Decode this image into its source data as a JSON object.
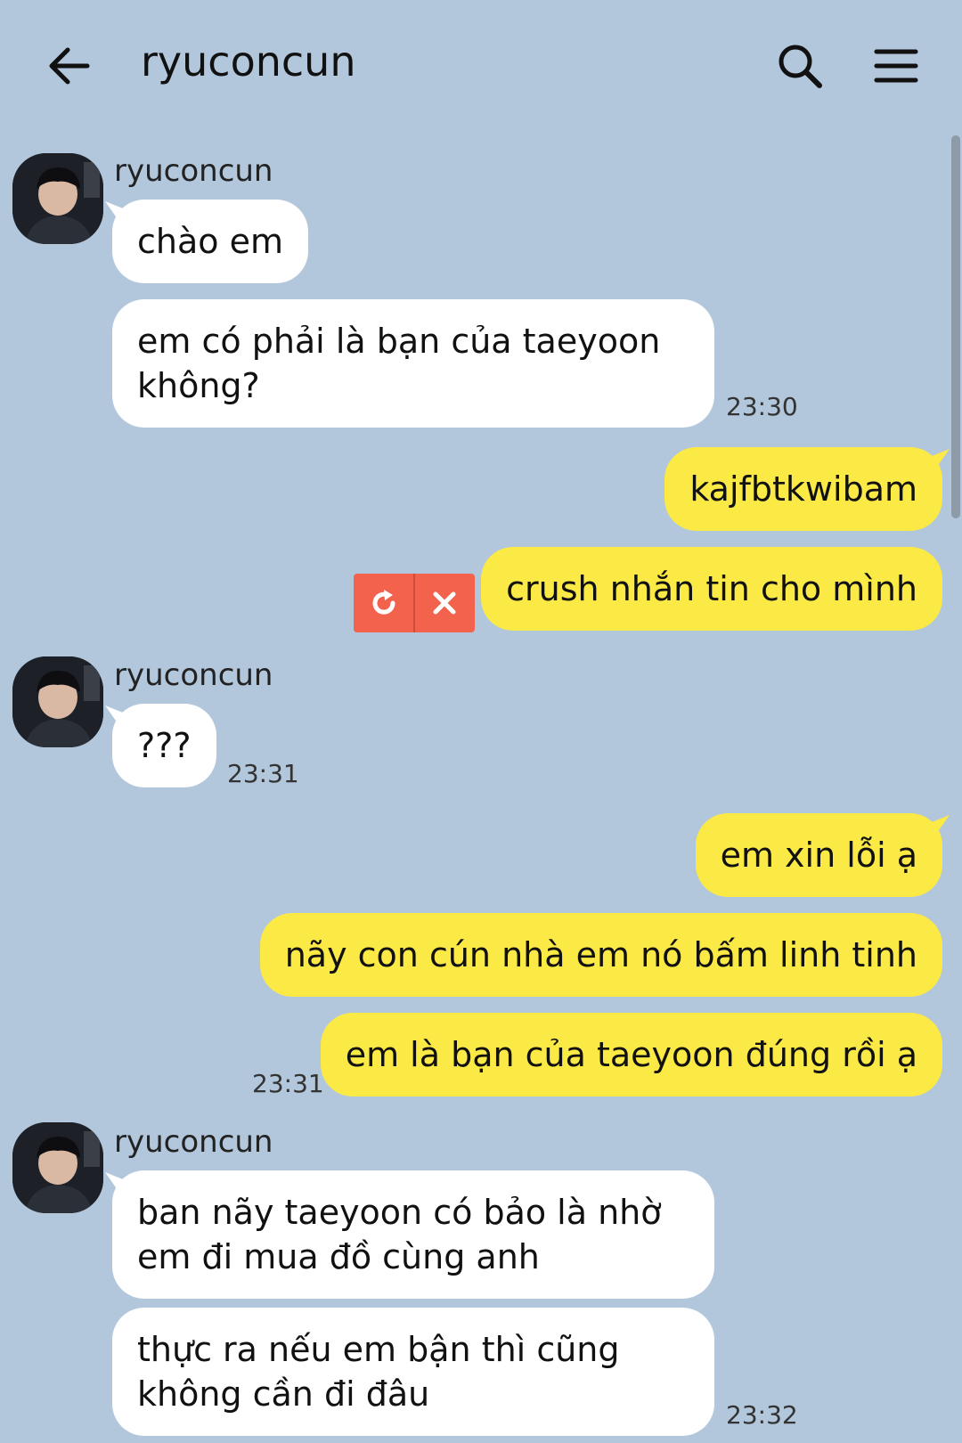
{
  "header": {
    "title": "ryuconcun",
    "back_icon": "arrow-left-icon",
    "search_icon": "search-icon",
    "menu_icon": "hamburger-menu-icon"
  },
  "colors": {
    "background": "#b2c7dc",
    "incoming_bubble": "#ffffff",
    "outgoing_bubble": "#fbe946",
    "failed_action": "#f2624d"
  },
  "messages": {
    "g1": {
      "sender": "ryuconcun",
      "m1": "chào em",
      "m2_l1": "em có phải là bạn của taeyoon",
      "m2_l2": "không?",
      "time": "23:30"
    },
    "o1": {
      "m1": "kajfbtkwibam",
      "m2": "crush nhắn tin cho mình",
      "retry_icon": "retry-icon",
      "delete_icon": "close-icon"
    },
    "g2": {
      "sender": "ryuconcun",
      "m1": "???",
      "time": "23:31"
    },
    "o2": {
      "m1": "em xin lỗi ạ",
      "m2": "nãy con cún nhà em nó bấm linh tinh",
      "m3": "em là bạn của taeyoon đúng rồi ạ",
      "time": "23:31"
    },
    "g3": {
      "sender": "ryuconcun",
      "m1_l1": "ban nãy taeyoon có bảo là nhờ",
      "m1_l2": "em đi mua đồ cùng anh",
      "m2_l1": "thực ra nếu em bận thì cũng",
      "m2_l2": "không cần đi đâu",
      "time": "23:32"
    }
  }
}
